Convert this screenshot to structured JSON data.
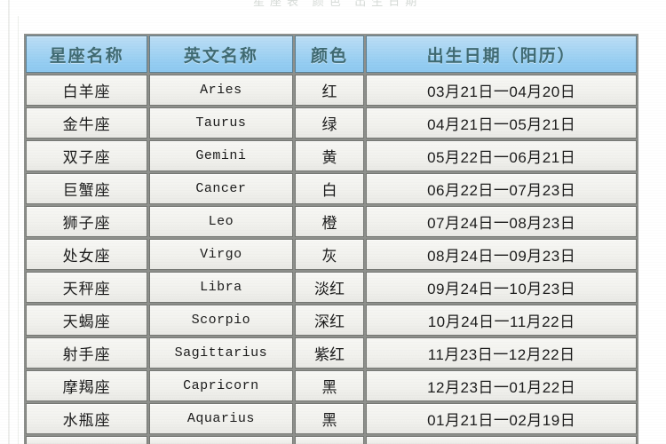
{
  "page": {
    "top_ghost_text": "星座表  颜色  出生日期"
  },
  "table": {
    "headers": [
      "星座名称",
      "英文名称",
      "颜色",
      "出生日期（阳历）"
    ],
    "rows": [
      {
        "name": "白羊座",
        "english": "Aries",
        "color": "红",
        "dates": "03月21日一04月20日"
      },
      {
        "name": "金牛座",
        "english": "Taurus",
        "color": "绿",
        "dates": "04月21日一05月21日"
      },
      {
        "name": "双子座",
        "english": "Gemini",
        "color": "黄",
        "dates": "05月22日一06月21日"
      },
      {
        "name": "巨蟹座",
        "english": "Cancer",
        "color": "白",
        "dates": "06月22日一07月23日"
      },
      {
        "name": "狮子座",
        "english": "Leo",
        "color": "橙",
        "dates": "07月24日一08月23日"
      },
      {
        "name": "处女座",
        "english": "Virgo",
        "color": "灰",
        "dates": "08月24日一09月23日"
      },
      {
        "name": "天秤座",
        "english": "Libra",
        "color": "淡红",
        "dates": "09月24日一10月23日"
      },
      {
        "name": "天蝎座",
        "english": "Scorpio",
        "color": "深红",
        "dates": "10月24日一11月22日"
      },
      {
        "name": "射手座",
        "english": "Sagittarius",
        "color": "紫红",
        "dates": "11月23日一12月22日"
      },
      {
        "name": "摩羯座",
        "english": "Capricorn",
        "color": "黑",
        "dates": "12月23日一01月22日"
      },
      {
        "name": "水瓶座",
        "english": "Aquarius",
        "color": "黑",
        "dates": "01月21日一02月19日"
      }
    ]
  },
  "colors": {
    "header_background": "#a9d6f3",
    "header_text": "#3f6a72",
    "cell_background": "#f1f1ed",
    "cell_text": "#1b1b1b",
    "grid_border": "#757773",
    "page_background": "#ffffff"
  }
}
